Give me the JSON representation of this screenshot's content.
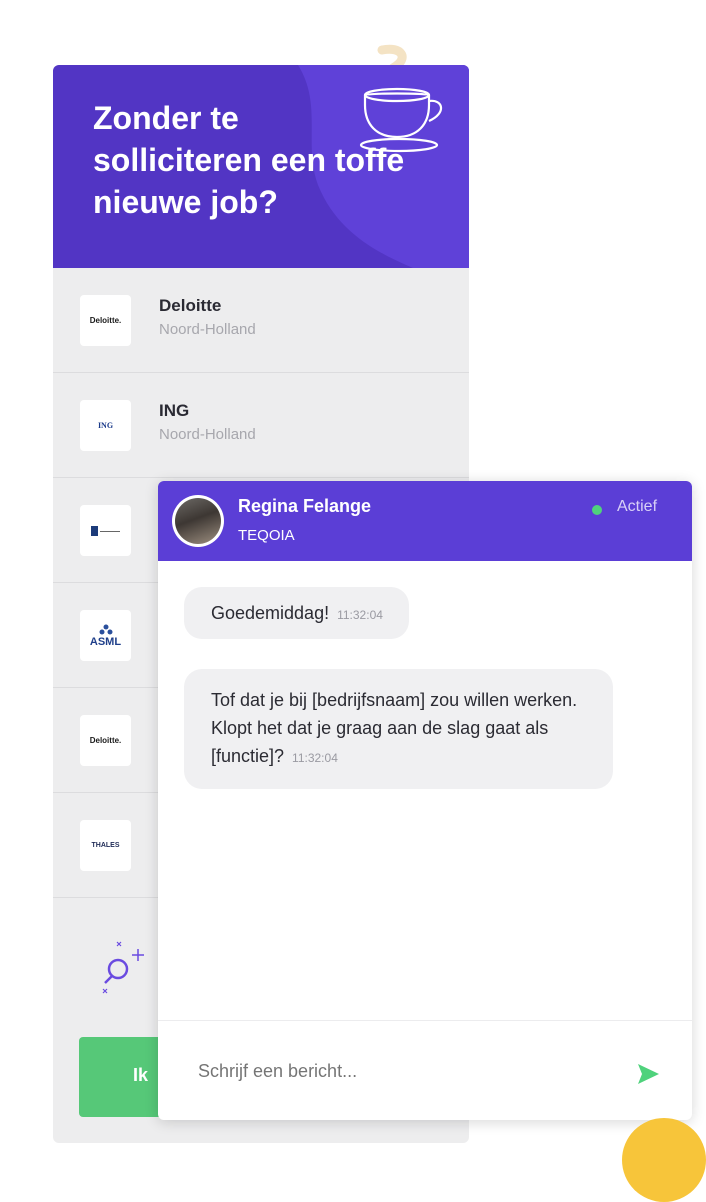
{
  "hero": {
    "title": "Zonder te solliciteren een toffe nieuwe job?",
    "icon": "coffee-cup-icon",
    "bg_color": "#5235c4"
  },
  "companies": [
    {
      "name": "Deloitte",
      "region": "Noord-Holland",
      "logo_text": "Deloitte."
    },
    {
      "name": "ING",
      "region": "Noord-Holland",
      "logo_text": "ING"
    },
    {
      "logo_text": ""
    },
    {
      "logo_text": "ASML"
    },
    {
      "logo_text": "Deloitte."
    },
    {
      "logo_text": "THALES"
    }
  ],
  "cta": {
    "label": "Ik",
    "color": "#56c878"
  },
  "chat": {
    "agent_name": "Regina Felange",
    "agent_company": "TEQOIA",
    "status": "Actief",
    "status_color": "#4fd27c",
    "header_color": "#5b3ed6",
    "messages": [
      {
        "text": "Goedemiddag!",
        "time": "11:32:04"
      },
      {
        "text": "Tof dat je bij [bedrijfsnaam] zou willen werken. Klopt het dat je graag aan de slag gaat als [functie]?",
        "time": "11:32:04"
      }
    ],
    "input_placeholder": "Schrijf een bericht...",
    "send_icon": "send-icon"
  }
}
